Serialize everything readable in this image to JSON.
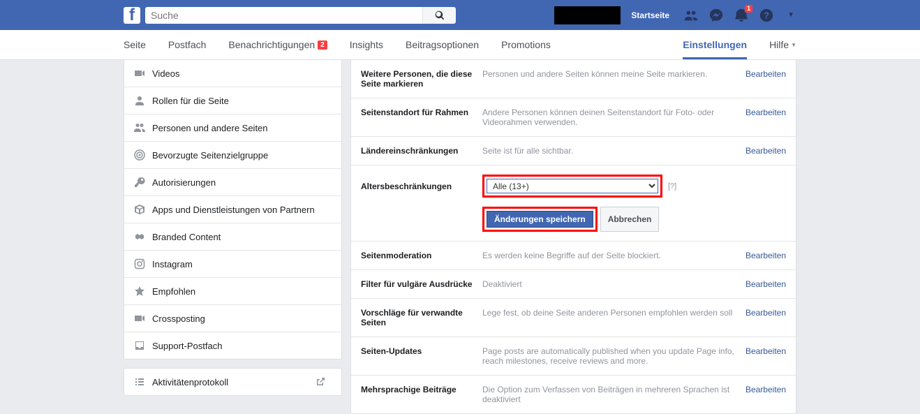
{
  "topbar": {
    "search_placeholder": "Suche",
    "home": "Startseite",
    "notif_count": "1"
  },
  "nav": {
    "seite": "Seite",
    "postfach": "Postfach",
    "benachrichtigungen": "Benachrichtigungen",
    "benachrichtigungen_badge": "2",
    "insights": "Insights",
    "beitragsoptionen": "Beitragsoptionen",
    "promotions": "Promotions",
    "einstellungen": "Einstellungen",
    "hilfe": "Hilfe"
  },
  "sidebar": {
    "videos": "Videos",
    "rollen": "Rollen für die Seite",
    "personen": "Personen und andere Seiten",
    "zielgruppe": "Bevorzugte Seitenzielgruppe",
    "autorisierungen": "Autorisierungen",
    "apps": "Apps und Dienstleistungen von Partnern",
    "branded": "Branded Content",
    "instagram": "Instagram",
    "empfohlen": "Empfohlen",
    "crossposting": "Crossposting",
    "support": "Support-Postfach",
    "aktivitaet": "Aktivitätenprotokoll"
  },
  "settings": {
    "edit": "Bearbeiten",
    "markieren": {
      "label": "Weitere Personen, die diese Seite markieren",
      "desc": "Personen und andere Seiten können meine Seite markieren."
    },
    "standort": {
      "label": "Seitenstandort für Rahmen",
      "desc": "Andere Personen können deinen Seitenstandort für Foto- oder Videorahmen verwenden."
    },
    "laender": {
      "label": "Ländereinschränkungen",
      "desc": "Seite ist für alle sichtbar."
    },
    "alter": {
      "label": "Altersbeschränkungen",
      "value": "Alle (13+)",
      "help": "[?]",
      "save": "Änderungen speichern",
      "cancel": "Abbrechen"
    },
    "moderation": {
      "label": "Seitenmoderation",
      "desc": "Es werden keine Begriffe auf der Seite blockiert."
    },
    "vulgaer": {
      "label": "Filter für vulgäre Ausdrücke",
      "desc": "Deaktiviert"
    },
    "vorschlaege": {
      "label": "Vorschläge für verwandte Seiten",
      "desc": "Lege fest, ob deine Seite anderen Personen empfohlen werden soll"
    },
    "updates": {
      "label": "Seiten-Updates",
      "desc": "Page posts are automatically published when you update Page info, reach milestones, receive reviews and more."
    },
    "mehrsprachig": {
      "label": "Mehrsprachige Beiträge",
      "desc": "Die Option zum Verfassen von Beiträgen in mehreren Sprachen ist deaktiviert"
    }
  }
}
